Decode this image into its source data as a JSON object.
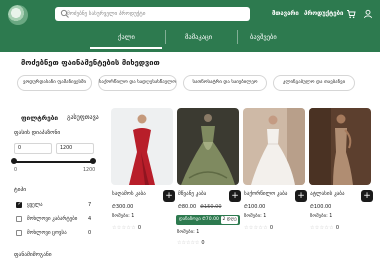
{
  "header": {
    "search_placeholder": "მოძებნე სასურველი პროდუქტი",
    "links": [
      "მთავარი",
      "პროდუქტები"
    ],
    "nav": [
      "ქალი",
      "მამაკაცი",
      "ბავშვები"
    ]
  },
  "categories": {
    "title": "მოძებნეთ ფაინამენტების მიხედვით",
    "chips": [
      "ვოდურდასანი ფამანივესმი",
      "საქორწილო და სადღესასწაულო",
      "სათნოსატრი და საიუბილეო",
      "კლინგაბულო და თავბანვი"
    ]
  },
  "filters": {
    "title": "ფილტრები",
    "clear": "გასუფთავა",
    "price_label": "ფასის დიაპაზონი",
    "min_value": "0",
    "max_value": "1200",
    "range_min": "0",
    "range_max": "1200",
    "type_label": "ტიპი",
    "types": [
      {
        "label": "ყველა",
        "count": "7",
        "checked": true
      },
      {
        "label": "მოხლოვი კაბარტები",
        "count": "4",
        "checked": false
      },
      {
        "label": "მოხლოვი ცოვსა",
        "count": "0",
        "checked": false
      }
    ],
    "more_label": "ფანამიმოგანი"
  },
  "products": [
    {
      "name": "საღამოს კაბა",
      "price": "₾300.00",
      "old_price": "",
      "size": "ზომები: 1",
      "rating_count": "0"
    },
    {
      "name": "მწვანე კაბა",
      "price": "₾80.00",
      "old_price": "₾150.00",
      "size": "ზომები: 1",
      "rating_count": "0"
    },
    {
      "name": "საქორწილო კაბა",
      "price": "₾100.00",
      "old_price": "",
      "size": "ზომები: 1",
      "rating_count": "0"
    },
    {
      "name": "ატლასის კაბა",
      "price": "₾100.00",
      "old_price": "",
      "size": "ზომები: 1",
      "rating_count": "0"
    }
  ],
  "promo": {
    "label": "დანაზოგი ₾70.00",
    "pill": "2 დღე"
  },
  "stars_text": "☆☆☆☆☆",
  "plus_symbol": "+",
  "colors": {
    "brand": "#2d7a4f",
    "dark": "#1a1a1a",
    "star": "#bbbbbb"
  },
  "icons": {
    "search": "search-icon",
    "cart": "cart-icon",
    "user": "user-icon",
    "add": "plus-icon"
  }
}
